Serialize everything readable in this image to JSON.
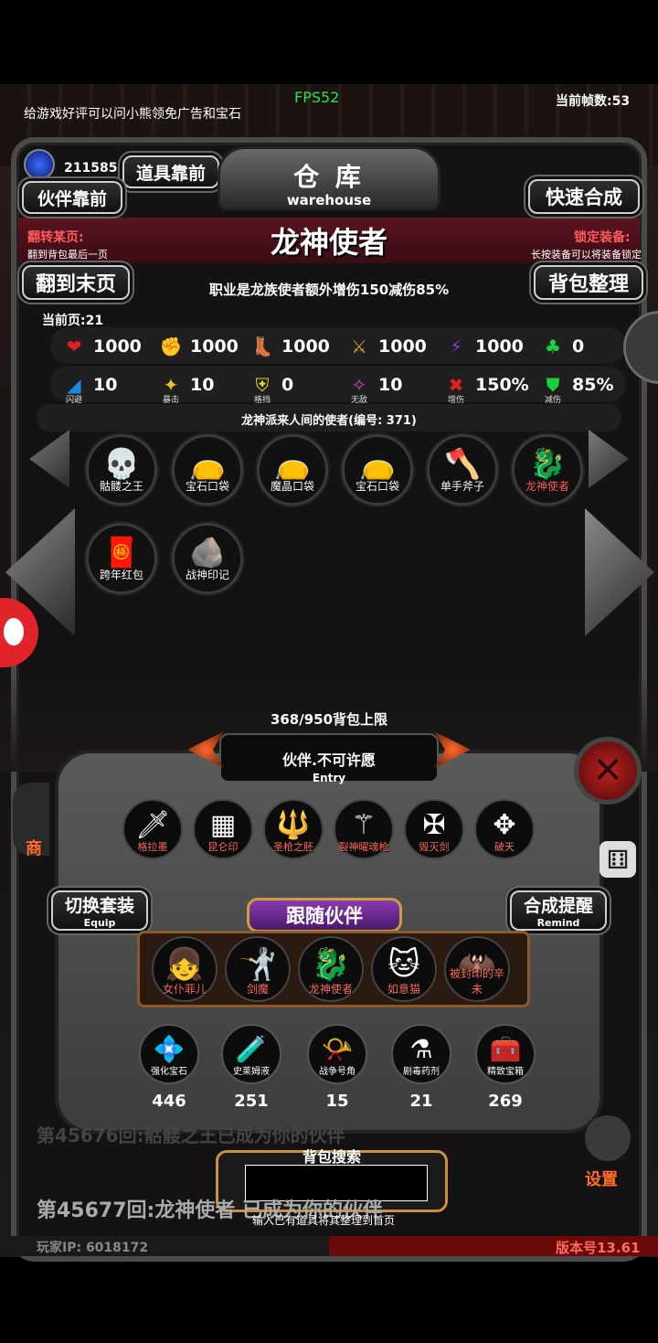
{
  "top": {
    "notice": "给游戏好评可以问小熊领免广告和宝石",
    "fps": "FPS52",
    "frame_rate": "当前帧数:53"
  },
  "header": {
    "currency": "211585",
    "items_first": "道具靠前",
    "partners_first": "伙伴靠前",
    "warehouse_title": "仓 库",
    "warehouse_en": "warehouse",
    "quick_merge": "快速合成",
    "flip_label": "翻转某页:",
    "flip_hint": "翻到背包最后一页",
    "lock_label": "锁定装备:",
    "lock_hint": "长按装备可以将装备锁定",
    "item_title": "龙神使者",
    "item_desc": "职业是龙族使者额外增伤150减伤85%",
    "last_page": "翻到末页",
    "sort_bag": "背包整理",
    "current_page": "当前页:21"
  },
  "stats_row1": [
    {
      "icon": "heart-icon",
      "glyph": "❤",
      "color": "#e0201c",
      "value": "1000"
    },
    {
      "icon": "strength-icon",
      "glyph": "✊",
      "color": "#e8c21a",
      "value": "1000"
    },
    {
      "icon": "boot-icon",
      "glyph": "👢",
      "color": "#1a8ae0",
      "value": "1000"
    },
    {
      "icon": "sword-icon",
      "glyph": "⚔",
      "color": "#c8a040",
      "value": "1000"
    },
    {
      "icon": "lightning-icon",
      "glyph": "⚡",
      "color": "#8a3ae0",
      "value": "1000"
    },
    {
      "icon": "clover-icon",
      "glyph": "♣",
      "color": "#1ad03a",
      "value": "0"
    }
  ],
  "stats_row2": [
    {
      "icon": "dodge-icon",
      "glyph": "◢",
      "color": "#1a8ae0",
      "value": "10",
      "label": "闪避"
    },
    {
      "icon": "crit-icon",
      "glyph": "✦",
      "color": "#e8c21a",
      "value": "10",
      "label": "暴击"
    },
    {
      "icon": "block-icon",
      "glyph": "⛨",
      "color": "#e8d81a",
      "value": "0",
      "label": "格挡"
    },
    {
      "icon": "invincible-icon",
      "glyph": "✧",
      "color": "#d040d0",
      "value": "10",
      "label": "无敌"
    },
    {
      "icon": "damage-up-icon",
      "glyph": "✖",
      "color": "#e02020",
      "value": "150%",
      "label": "增伤"
    },
    {
      "icon": "damage-reduce-icon",
      "glyph": "⛊",
      "color": "#1ad03a",
      "value": "85%",
      "label": "减伤"
    }
  ],
  "item_origin": "龙神派来人间的使者(编号: 371)",
  "inventory": [
    {
      "name": "骷髅之王",
      "glyph": "💀",
      "icon": "skeleton-king-icon"
    },
    {
      "name": "宝石口袋",
      "glyph": "👝",
      "icon": "gem-pouch-icon"
    },
    {
      "name": "魔晶口袋",
      "glyph": "👝",
      "icon": "crystal-pouch-icon"
    },
    {
      "name": "宝石口袋",
      "glyph": "👝",
      "icon": "gem-pouch-icon"
    },
    {
      "name": "单手斧子",
      "glyph": "🪓",
      "icon": "axe-icon"
    },
    {
      "name": "龙神使者",
      "glyph": "🐉",
      "icon": "dragon-envoy-icon"
    },
    {
      "name": "跨年红包",
      "glyph": "🧧",
      "icon": "red-envelope-icon"
    },
    {
      "name": "战神印记",
      "glyph": "🪨",
      "icon": "war-god-seal-icon"
    }
  ],
  "capacity": "368/950背包上限",
  "entry": {
    "title": "伙伴.不可许愿",
    "subtitle": "Entry"
  },
  "equip_slots": [
    {
      "name": "格拉墨",
      "glyph": "🗡",
      "icon": "gram-sword-icon"
    },
    {
      "name": "昆仑印",
      "glyph": "▦",
      "icon": "kunlun-seal-icon"
    },
    {
      "name": "圣枪之胚",
      "glyph": "🔱",
      "icon": "holy-spear-icon"
    },
    {
      "name": "裂神曜魂枪",
      "glyph": "⚚",
      "icon": "soul-spear-icon"
    },
    {
      "name": "毁灭剑",
      "glyph": "✠",
      "icon": "destruction-sword-icon"
    },
    {
      "name": "破天",
      "glyph": "✥",
      "icon": "sky-breaker-icon"
    }
  ],
  "switch_set": {
    "label": "切换套装",
    "sub": "Equip"
  },
  "merge_remind": {
    "label": "合成提醒",
    "sub": "Remind"
  },
  "follow_title": "跟随伙伴",
  "companions": [
    {
      "name": "女仆菲儿",
      "glyph": "👧",
      "icon": "maid-companion-icon"
    },
    {
      "name": "剑魔",
      "glyph": "🤺",
      "icon": "sword-demon-icon"
    },
    {
      "name": "龙神使者",
      "glyph": "🐉",
      "icon": "dragon-envoy-icon"
    },
    {
      "name": "如意猫",
      "glyph": "🐱",
      "icon": "nyan-cat-icon"
    },
    {
      "name": "被封印的辛未",
      "glyph": "🦇",
      "icon": "sealed-demon-icon"
    }
  ],
  "resources": [
    {
      "name": "强化宝石",
      "glyph": "💠",
      "icon": "enhance-gem-icon",
      "count": "446"
    },
    {
      "name": "史莱姆液",
      "glyph": "🧪",
      "icon": "slime-potion-icon",
      "count": "251"
    },
    {
      "name": "战争号角",
      "glyph": "📯",
      "icon": "war-horn-icon",
      "count": "15"
    },
    {
      "name": "剧毒药剂",
      "glyph": "⚗",
      "icon": "poison-potion-icon",
      "count": "21"
    },
    {
      "name": "精致宝箱",
      "glyph": "🧰",
      "icon": "treasure-chest-icon",
      "count": "269"
    }
  ],
  "search": {
    "label": "背包搜索",
    "value": "",
    "hint": "输入已有道具将其整理到首页"
  },
  "ticker": "第45677回:龙神使者 已成为你的伙伴",
  "ticker_ghost": "第45676回:骷髅之王已成为你的伙伴",
  "footer": {
    "player_ip": "玩家IP: 6018172",
    "version": "版本号13.61"
  },
  "side": {
    "shop": "商",
    "settings": "设置"
  }
}
